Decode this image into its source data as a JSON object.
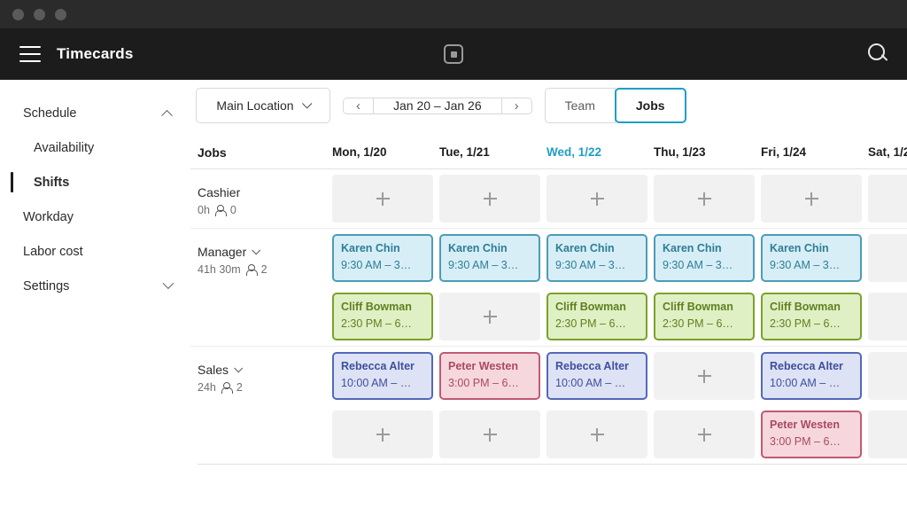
{
  "window": {
    "dots": 3
  },
  "appbar": {
    "menu_icon": "hamburger-icon",
    "title": "Timecards",
    "logo_icon": "square-logo-icon",
    "search_icon": "search-icon"
  },
  "sidebar": {
    "items": [
      {
        "label": "Schedule",
        "level": "top",
        "active": false,
        "chevron": "up"
      },
      {
        "label": "Availability",
        "level": "sub",
        "active": false,
        "chevron": ""
      },
      {
        "label": "Shifts",
        "level": "sub",
        "active": true,
        "chevron": ""
      },
      {
        "label": "Workday",
        "level": "top",
        "active": false,
        "chevron": ""
      },
      {
        "label": "Labor cost",
        "level": "top",
        "active": false,
        "chevron": ""
      },
      {
        "label": "Settings",
        "level": "top",
        "active": false,
        "chevron": "down"
      }
    ]
  },
  "toolbar": {
    "location_label": "Main Location",
    "prev_label": "‹",
    "date_range": "Jan 20 – Jan 26",
    "next_label": "›",
    "view_team": "Team",
    "view_jobs": "Jobs",
    "view_selected": "Jobs",
    "accent_color": "#1f9ec4"
  },
  "grid": {
    "job_column_header": "Jobs",
    "days": [
      {
        "label": "Mon, 1/20",
        "today": false
      },
      {
        "label": "Tue, 1/21",
        "today": false
      },
      {
        "label": "Wed, 1/22",
        "today": true
      },
      {
        "label": "Thu, 1/23",
        "today": false
      },
      {
        "label": "Fri, 1/24",
        "today": false
      },
      {
        "label": "Sat, 1/2",
        "today": false
      }
    ],
    "add_icon": "plus-icon",
    "people_icon": "person-icon",
    "jobs": [
      {
        "name": "Cashier",
        "hours": "0h",
        "people": "0",
        "has_chevron": false,
        "rows": [
          [
            null,
            null,
            null,
            null,
            null,
            null
          ]
        ]
      },
      {
        "name": "Manager",
        "hours": "41h 30m",
        "people": "2",
        "has_chevron": true,
        "rows": [
          [
            {
              "name": "Karen Chin",
              "time": "9:30 AM – 3…",
              "color": "blue"
            },
            {
              "name": "Karen Chin",
              "time": "9:30 AM – 3…",
              "color": "blue"
            },
            {
              "name": "Karen Chin",
              "time": "9:30 AM – 3…",
              "color": "blue"
            },
            {
              "name": "Karen Chin",
              "time": "9:30 AM – 3…",
              "color": "blue"
            },
            {
              "name": "Karen Chin",
              "time": "9:30 AM – 3…",
              "color": "blue"
            },
            null
          ],
          [
            {
              "name": "Cliff Bowman",
              "time": "2:30 PM – 6…",
              "color": "green"
            },
            null,
            {
              "name": "Cliff Bowman",
              "time": "2:30 PM – 6…",
              "color": "green"
            },
            {
              "name": "Cliff Bowman",
              "time": "2:30 PM – 6…",
              "color": "green"
            },
            {
              "name": "Cliff Bowman",
              "time": "2:30 PM – 6…",
              "color": "green"
            },
            null
          ]
        ]
      },
      {
        "name": "Sales",
        "hours": "24h",
        "people": "2",
        "has_chevron": true,
        "rows": [
          [
            {
              "name": "Rebecca Alter",
              "time": "10:00 AM – …",
              "color": "indigo"
            },
            {
              "name": "Peter Westen",
              "time": "3:00 PM – 6…",
              "color": "pink"
            },
            {
              "name": "Rebecca Alter",
              "time": "10:00 AM – …",
              "color": "indigo"
            },
            null,
            {
              "name": "Rebecca Alter",
              "time": "10:00 AM – …",
              "color": "indigo"
            },
            null
          ],
          [
            null,
            null,
            null,
            null,
            {
              "name": "Peter Westen",
              "time": "3:00 PM – 6…",
              "color": "pink"
            },
            null
          ]
        ]
      }
    ]
  }
}
